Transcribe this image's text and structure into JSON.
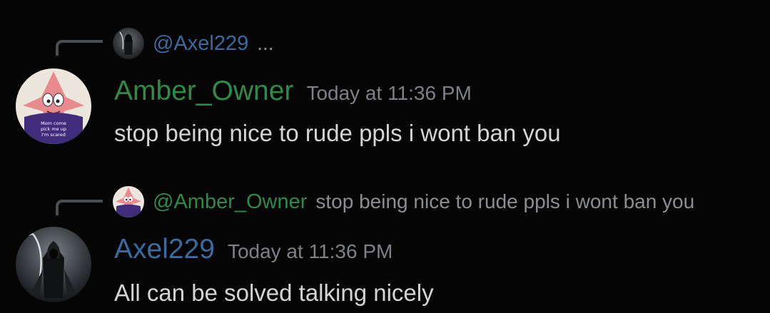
{
  "messages": [
    {
      "reply": {
        "name": "@Axel229",
        "content": "..."
      },
      "author": {
        "name": "Amber_Owner",
        "avatar_icon": "starfish-avatar"
      },
      "timestamp": "Today at 11:36 PM",
      "content": "stop being nice to rude ppls i wont ban you"
    },
    {
      "reply": {
        "name": "@Amber_Owner",
        "content": "stop being nice to rude ppls i wont ban you"
      },
      "author": {
        "name": "Axel229",
        "avatar_icon": "hooded-figure-avatar"
      },
      "timestamp": "Today at 11:36 PM",
      "content": "All can be solved talking nicely"
    }
  ],
  "colors": {
    "background": "#050505",
    "amber_name": "#2f8a48",
    "axel_name": "#3b6a9e",
    "timestamp": "#7d8086",
    "message_text": "#d2d4d6",
    "reply_text": "#8a8d92"
  }
}
